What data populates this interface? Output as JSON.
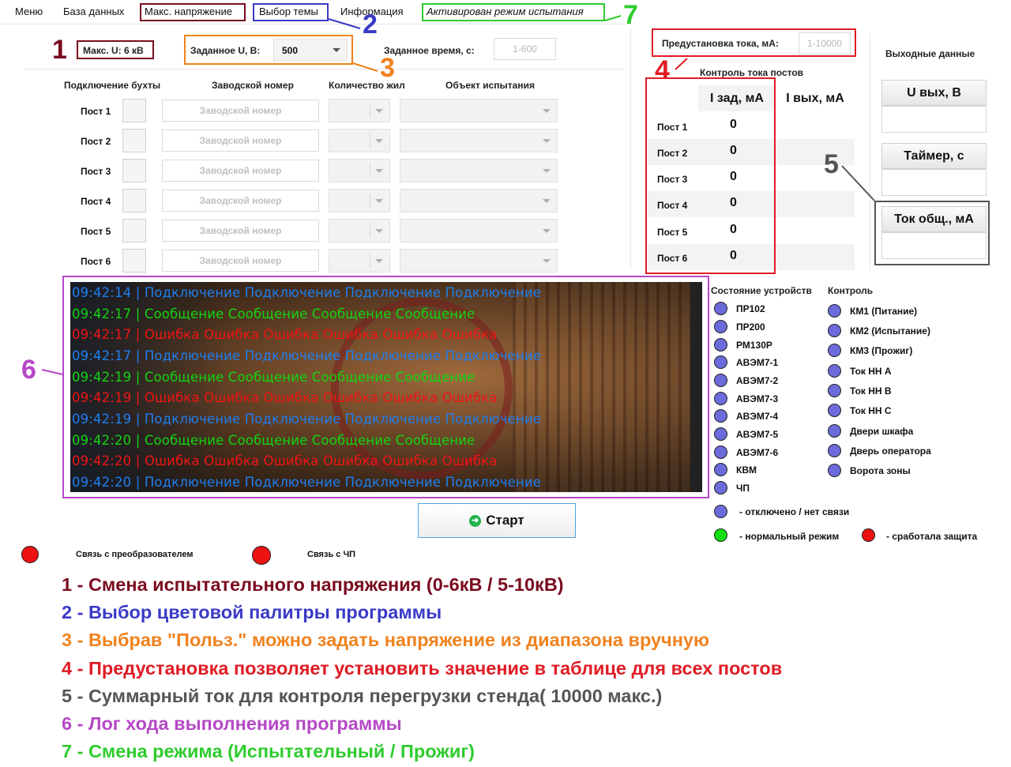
{
  "menu": {
    "items": [
      "Меню",
      "База данных",
      "Макс. напряжение",
      "Выбор темы",
      "Информация",
      "Активирован режим испытания"
    ]
  },
  "top": {
    "max_u": "Макс. U: 6 кВ",
    "set_u_label": "Заданное U, В:",
    "set_u_value": "500",
    "set_time_label": "Заданное время, с:",
    "set_time_placeholder": "1-600",
    "preset_label": "Предустановка тока, мА:",
    "preset_placeholder": "1-10000"
  },
  "columns": {
    "connect": "Подключение бухты",
    "serial": "Заводской номер",
    "cores": "Количество жил",
    "object": "Объект испытания"
  },
  "posts": [
    {
      "label": "Пост 1",
      "serial_placeholder": "Заводской номер"
    },
    {
      "label": "Пост 2",
      "serial_placeholder": "Заводской номер"
    },
    {
      "label": "Пост 3",
      "serial_placeholder": "Заводской номер"
    },
    {
      "label": "Пост 4",
      "serial_placeholder": "Заводской номер"
    },
    {
      "label": "Пост 5",
      "serial_placeholder": "Заводской номер"
    },
    {
      "label": "Пост 6",
      "serial_placeholder": "Заводской номер"
    }
  ],
  "current_control": {
    "title": "Контроль тока постов",
    "col_set": "I зад, мА",
    "col_out": "I вых, мА",
    "rows": [
      {
        "post": "Пост 1",
        "i_set": "0"
      },
      {
        "post": "Пост 2",
        "i_set": "0"
      },
      {
        "post": "Пост 3",
        "i_set": "0"
      },
      {
        "post": "Пост 4",
        "i_set": "0"
      },
      {
        "post": "Пост 5",
        "i_set": "0"
      },
      {
        "post": "Пост 6",
        "i_set": "0"
      }
    ]
  },
  "output": {
    "title": "Выходные данные",
    "u_out": "U вых, В",
    "timer": "Таймер, с",
    "current_total": "Ток общ., мА"
  },
  "log": [
    {
      "time": "09:42:14",
      "text": "Подключение Подключение Подключение Подключение",
      "color": "#1e7ff0"
    },
    {
      "time": "09:42:17",
      "text": "Сообщение Сообщение Сообщение Сообщение",
      "color": "#12d412"
    },
    {
      "time": "09:42:17",
      "text": "Ошибка Ошибка Ошибка Ошибка Ошибка Ошибка",
      "color": "#f01414"
    },
    {
      "time": "09:42:17",
      "text": "Подключение Подключение Подключение Подключение",
      "color": "#1e7ff0"
    },
    {
      "time": "09:42:19",
      "text": "Сообщение Сообщение Сообщение Сообщение",
      "color": "#12d412"
    },
    {
      "time": "09:42:19",
      "text": "Ошибка Ошибка Ошибка Ошибка Ошибка Ошибка",
      "color": "#f01414"
    },
    {
      "time": "09:42:19",
      "text": "Подключение Подключение Подключение Подключение",
      "color": "#1e7ff0"
    },
    {
      "time": "09:42:20",
      "text": "Сообщение Сообщение Сообщение Сообщение",
      "color": "#12d412"
    },
    {
      "time": "09:42:20",
      "text": "Ошибка Ошибка Ошибка Ошибка Ошибка Ошибка",
      "color": "#f01414"
    },
    {
      "time": "09:42:20",
      "text": "Подключение Подключение Подключение Подключение",
      "color": "#1e7ff0"
    }
  ],
  "devices": {
    "title": "Состояние устройств",
    "items": [
      "ПР102",
      "ПР200",
      "РМ130Р",
      "АВЭМ7-1",
      "АВЭМ7-2",
      "АВЭМ7-3",
      "АВЭМ7-4",
      "АВЭМ7-5",
      "АВЭМ7-6",
      "КВМ",
      "ЧП"
    ]
  },
  "control": {
    "title": "Контроль",
    "items": [
      "КМ1 (Питание)",
      "КМ2 (Испытание)",
      "КМ3 (Прожиг)",
      "Ток НН А",
      "Ток НН В",
      "Ток НН С",
      "Двери шкафа",
      "Дверь оператора",
      "Ворота зоны"
    ]
  },
  "status_legend": {
    "off": "- отключено / нет связи",
    "normal": "- нормальный режим",
    "fault": "- сработала защита"
  },
  "start_button": "Старт",
  "connections": {
    "converter": "Связь с преобразователем",
    "vfd": "Связь с ЧП"
  },
  "annotations": {
    "numbers": [
      "1",
      "2",
      "3",
      "4",
      "5",
      "6",
      "7"
    ],
    "legend": [
      {
        "text": "1 - Смена испытательного напряжения (0-6кВ / 5-10кВ)",
        "color": "#7a0c1e"
      },
      {
        "text": "2 - Выбор цветовой палитры программы",
        "color": "#3a3ac8"
      },
      {
        "text": "3 - Выбрав \"Польз.\" можно задать напряжение из диапазона вручную",
        "color": "#f0821e"
      },
      {
        "text": "4 - Предустановка позволяет установить значение в таблице для всех постов",
        "color": "#e01b24"
      },
      {
        "text": "5 - Суммарный ток для контроля перегрузки стенда( 10000 макс.)",
        "color": "#555555"
      },
      {
        "text": "6 - Лог хода выполнения программы",
        "color": "#b548c6"
      },
      {
        "text": "7 - Смена режима (Испытательный / Прожиг)",
        "color": "#2ecc2e"
      }
    ]
  },
  "colors": {
    "anno1": "#7a0c1e",
    "anno2": "#3a3ac8",
    "anno3": "#f0821e",
    "anno4": "#e01b24",
    "anno5": "#555555",
    "anno6": "#b548c6",
    "anno7": "#2ecc2e"
  }
}
